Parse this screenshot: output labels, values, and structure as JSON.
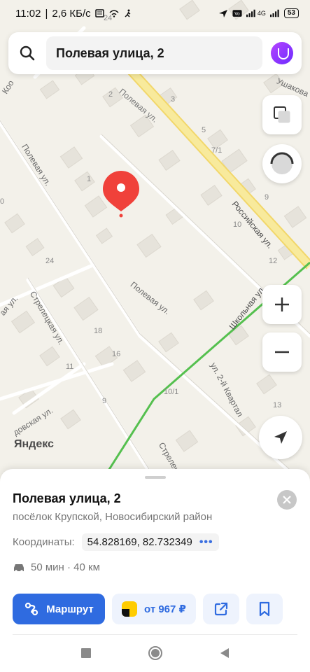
{
  "status_bar": {
    "time": "11:02",
    "speed": "2,6 КБ/с",
    "network": "4G",
    "battery": "53"
  },
  "search": {
    "query": "Полевая улица, 2"
  },
  "map": {
    "street_labels": [
      "Полевая ул.",
      "Полевая ул.",
      "Полевая ул.",
      "Стрелецкая ул.",
      "Российская ул.",
      "Школьная ул.",
      "ул. 2-й Квартал",
      "Стрелецкая",
      "Ушакова",
      "Коо",
      "ая ул.",
      "довская ул."
    ],
    "house_numbers": [
      "24",
      "2",
      "3",
      "5",
      "7/1",
      "9",
      "10",
      "12",
      "1",
      "24",
      "18",
      "16",
      "11",
      "9",
      "10/1",
      "13",
      "0"
    ],
    "logo": "Яндекс"
  },
  "map_controls": {
    "layers_icon": "layers-icon",
    "compass_icon": "compass-icon",
    "zoom_in": "+",
    "zoom_out": "−",
    "locate_icon": "locate-arrow-icon"
  },
  "place": {
    "title": "Полевая улица, 2",
    "subtitle": "посёлок Крупской, Новосибирский район",
    "coords_label": "Координаты:",
    "coords_value": "54.828169, 82.732349",
    "coords_more": "•••",
    "drive": "50 мин · 40 км"
  },
  "actions": {
    "route_label": "Маршрут",
    "taxi_label": "от 967 ₽"
  },
  "colors": {
    "accent": "#2f6be0",
    "pin": "#f0413a",
    "main_road": "#f7e58d",
    "rail": "#4fbf4a"
  }
}
